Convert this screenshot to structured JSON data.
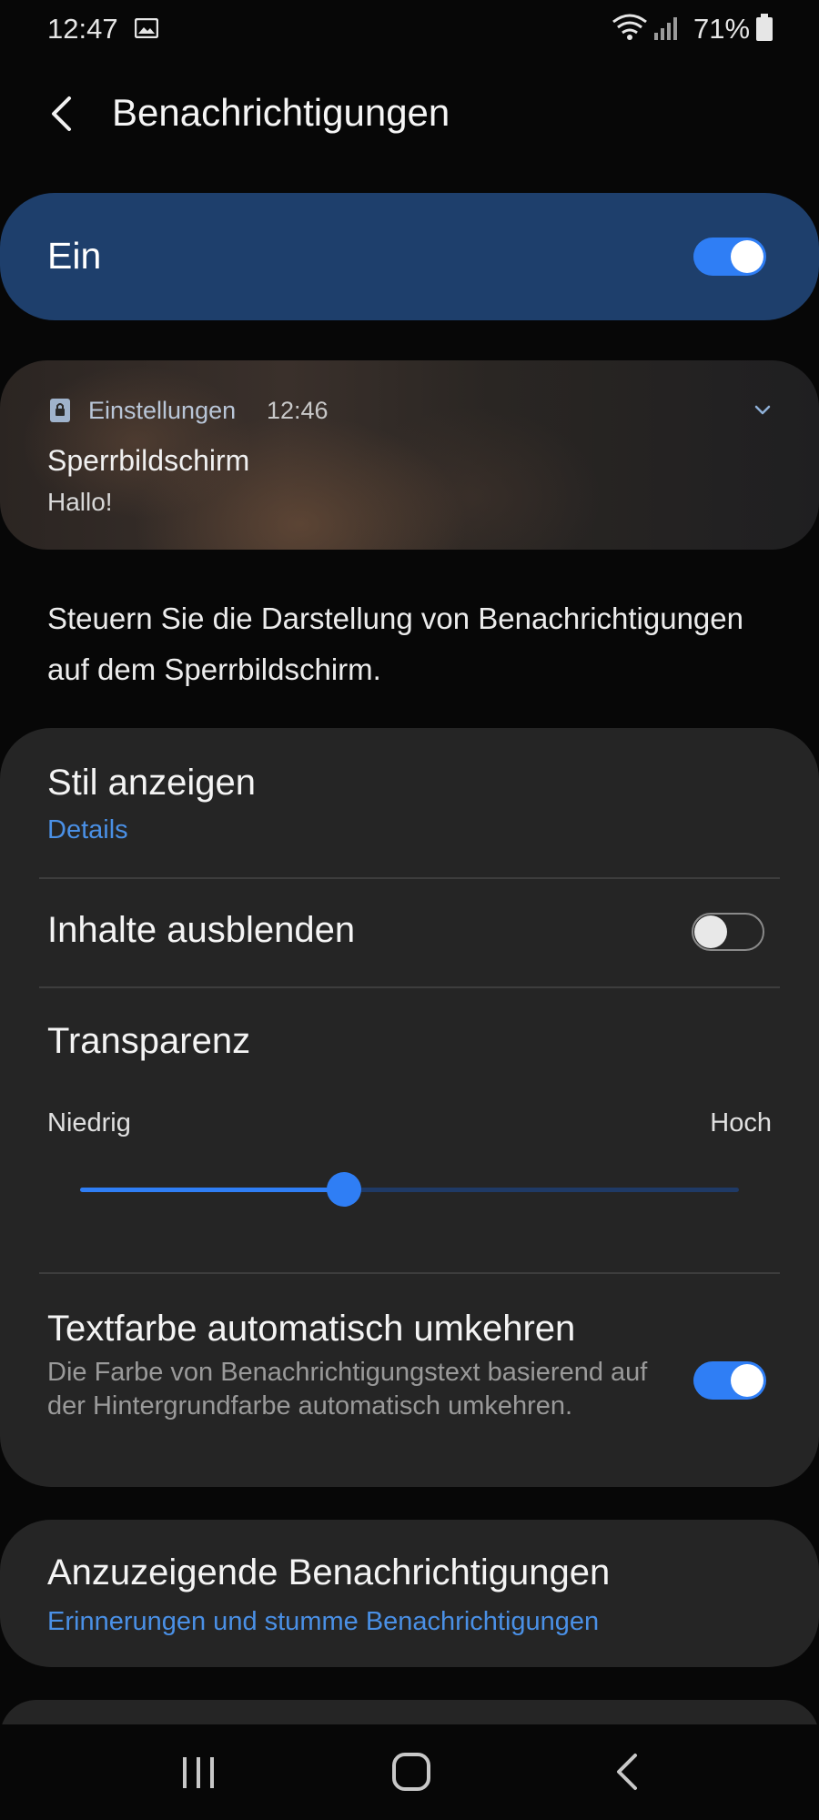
{
  "status_bar": {
    "time": "12:47",
    "battery_percent": "71%",
    "icons": [
      "image-icon",
      "wifi-icon",
      "signal-icon",
      "battery-icon"
    ]
  },
  "header": {
    "title": "Benachrichtigungen",
    "back_icon": "chevron-left-icon"
  },
  "master_switch": {
    "label": "Ein",
    "on": true
  },
  "preview": {
    "app_name": "Einstellungen",
    "time": "12:46",
    "title": "Sperrbildschirm",
    "text": "Hallo!",
    "icons": [
      "lock-icon",
      "chevron-down-icon"
    ]
  },
  "description": "Steuern Sie die Darstellung von Benachrichtigungen auf dem Sperrbildschirm.",
  "settings": {
    "style": {
      "title": "Stil anzeigen",
      "value": "Details"
    },
    "hide_content": {
      "title": "Inhalte ausblenden",
      "on": false
    },
    "transparency": {
      "title": "Transparenz",
      "min_label": "Niedrig",
      "max_label": "Hoch",
      "value_fraction": 0.4
    },
    "invert_text": {
      "title": "Textfarbe automatisch umkehren",
      "description": "Die Farbe von Benachrichtigungstext basierend auf der Hintergrundfarbe automatisch umkehren.",
      "on": true
    }
  },
  "notifications_to_show": {
    "title": "Anzuzeigende Benachrichtigungen",
    "value": "Erinnerungen und stumme Benachrichtigungen"
  },
  "colors": {
    "accent": "#2f7ef5",
    "link": "#4a90e6",
    "master_background": "#1e3f6c",
    "card_background": "#252525"
  },
  "nav_bar": {
    "icons": [
      "recents-icon",
      "home-icon",
      "back-icon"
    ]
  }
}
